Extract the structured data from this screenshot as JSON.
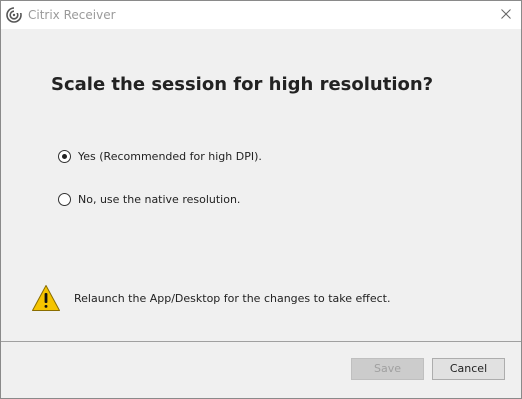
{
  "window": {
    "title": "Citrix Receiver"
  },
  "dialog": {
    "heading": "Scale the session for high resolution?",
    "options": [
      {
        "label": "Yes (Recommended for high DPI).",
        "selected": true
      },
      {
        "label": "No, use the native resolution.",
        "selected": false
      }
    ],
    "warning_text": "Relaunch the App/Desktop for the changes to take effect."
  },
  "buttons": {
    "save_label": "Save",
    "save_enabled": false,
    "cancel_label": "Cancel"
  },
  "colors": {
    "dialog_background": "#f0f0f0",
    "warning_yellow": "#f5c400",
    "disabled_text": "#a0a0a0"
  },
  "icons": {
    "app": "citrix-receiver-icon",
    "close": "close-icon",
    "warning": "warning-icon"
  }
}
